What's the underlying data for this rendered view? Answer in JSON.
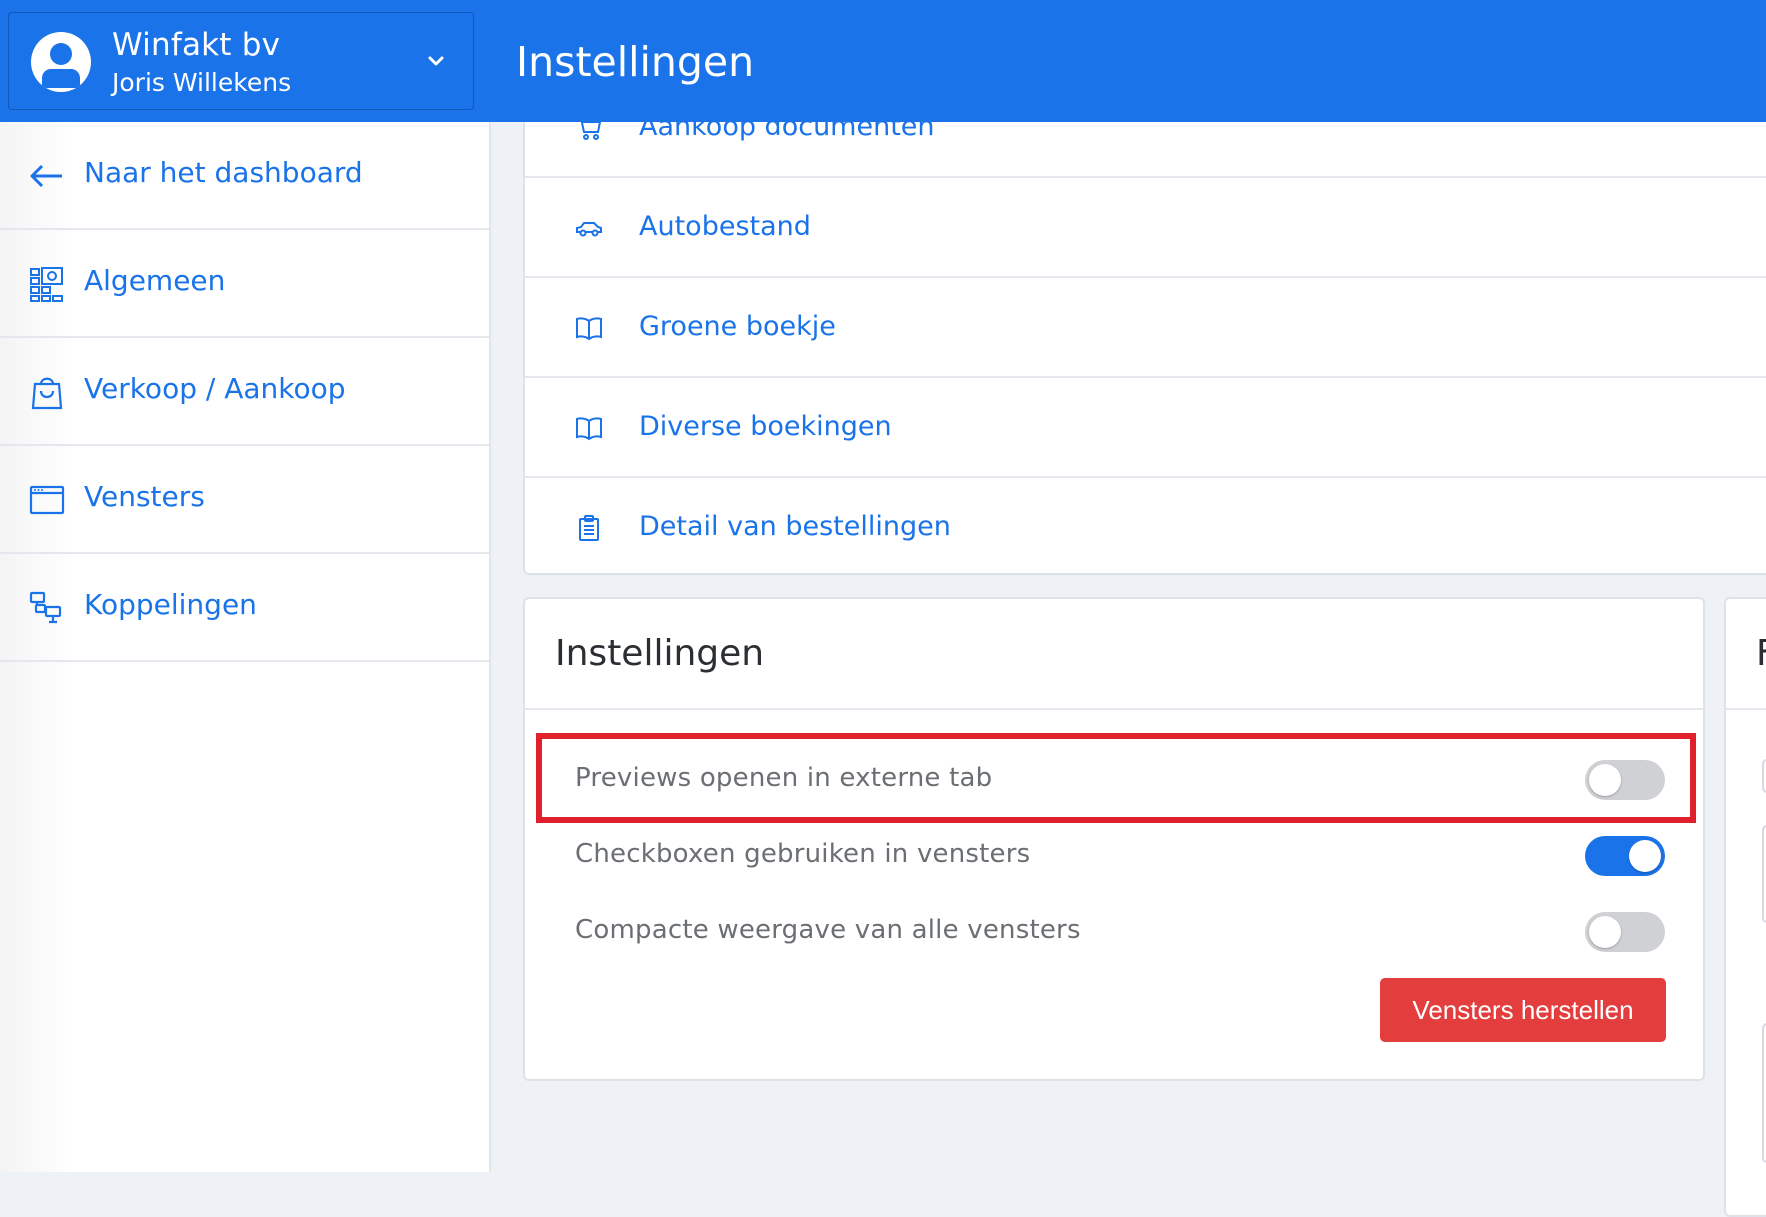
{
  "header": {
    "company": "Winfakt bv",
    "user": "Joris Willekens",
    "page_title": "Instellingen"
  },
  "sidebar": {
    "items": [
      {
        "label": "Naar het dashboard",
        "icon": "arrow-left-icon"
      },
      {
        "label": "Algemeen",
        "icon": "settings-grid-icon"
      },
      {
        "label": "Verkoop / Aankoop",
        "icon": "shopping-bag-icon"
      },
      {
        "label": "Vensters",
        "icon": "window-icon"
      },
      {
        "label": "Koppelingen",
        "icon": "network-icon"
      }
    ]
  },
  "document_list": {
    "items": [
      {
        "label": "Aankoop documenten",
        "icon": "cart-icon"
      },
      {
        "label": "Autobestand",
        "icon": "car-icon"
      },
      {
        "label": "Groene boekje",
        "icon": "book-icon"
      },
      {
        "label": "Diverse boekingen",
        "icon": "book-icon"
      },
      {
        "label": "Detail van bestellingen",
        "icon": "clipboard-icon"
      }
    ]
  },
  "settings": {
    "title": "Instellingen",
    "options": [
      {
        "label": "Previews openen in externe tab",
        "enabled": false
      },
      {
        "label": "Checkboxen gebruiken in vensters",
        "enabled": true
      },
      {
        "label": "Compacte weergave van alle vensters",
        "enabled": false
      }
    ],
    "reset_label": "Vensters herstellen"
  },
  "right_panel": {
    "title_fragment": "F"
  },
  "colors": {
    "primary": "#1a73e8",
    "danger": "#e33d3d",
    "highlight": "#e0212d",
    "toggle_off": "#cfd1d4"
  }
}
